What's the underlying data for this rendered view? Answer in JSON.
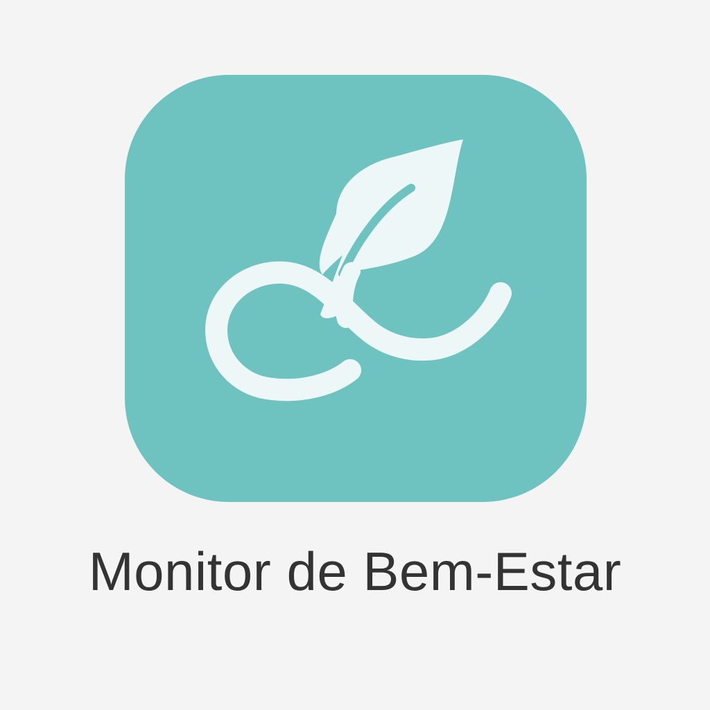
{
  "app": {
    "name": "Monitor de Bem-Estar",
    "icon": "sprout-infinity-icon"
  },
  "colors": {
    "background": "#f4f4f4",
    "tile": "#6ec3c1",
    "glyph": "#eef7f7",
    "label": "#333333"
  }
}
